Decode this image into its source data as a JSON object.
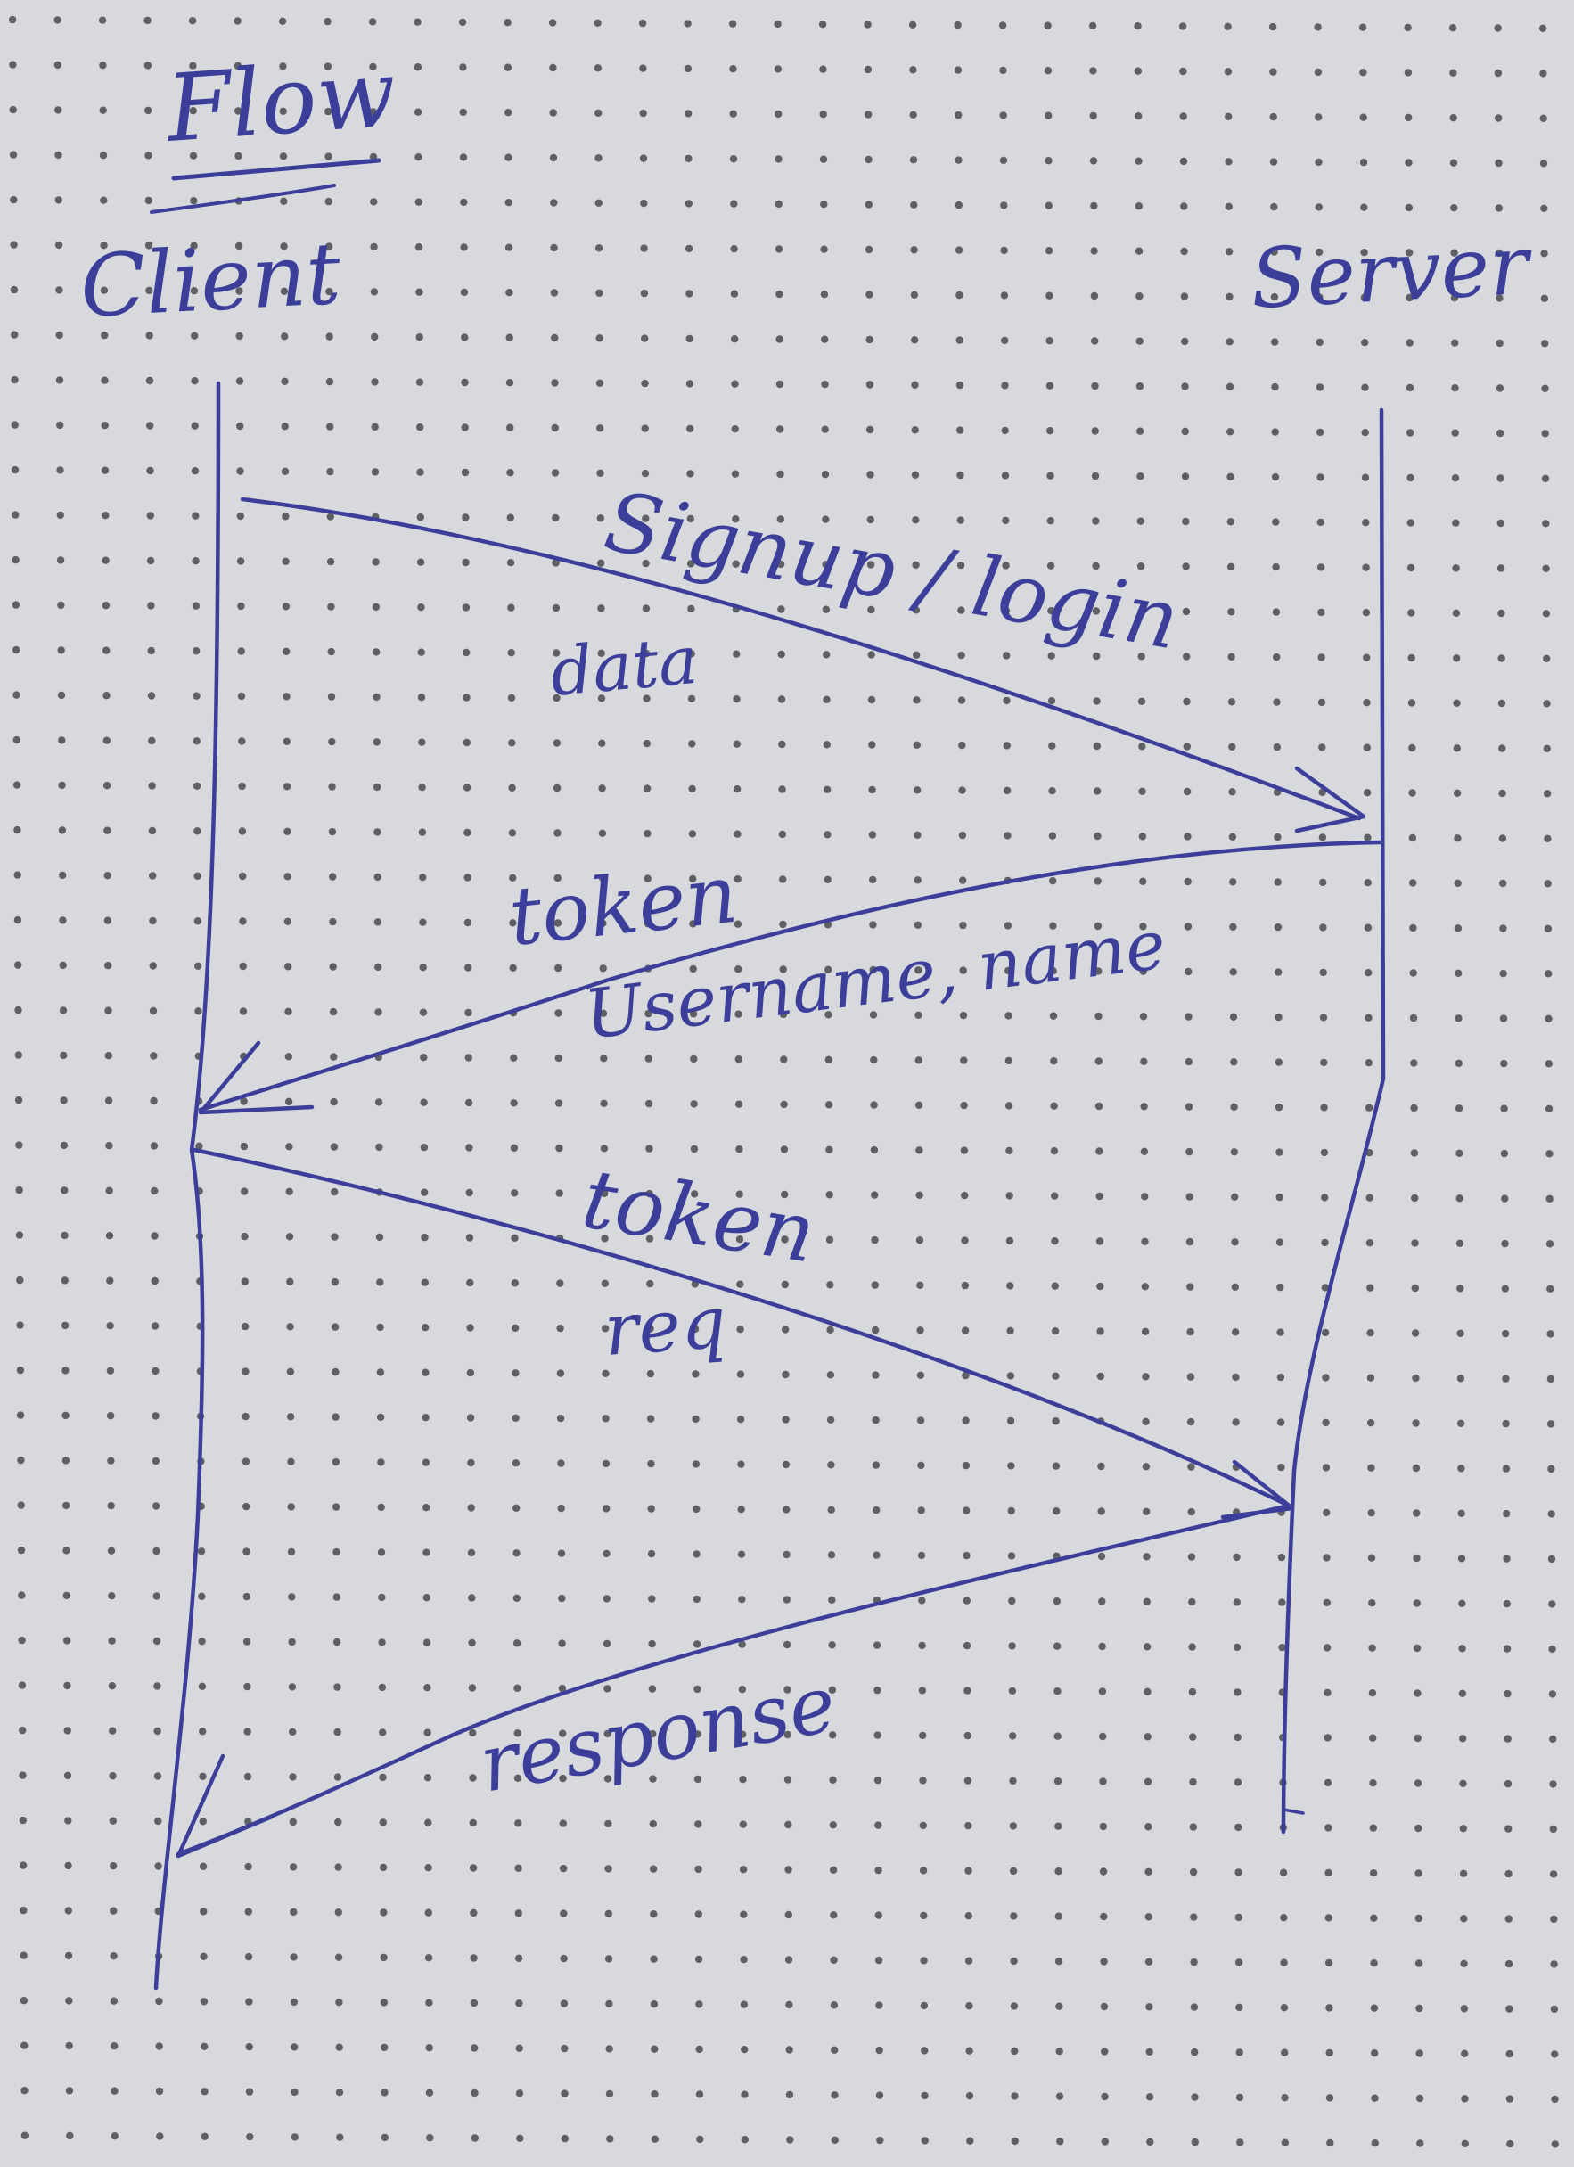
{
  "title": "Flow",
  "participants": {
    "client": "Client",
    "server": "Server"
  },
  "messages": [
    {
      "label": "Signup / login",
      "sublabel": "data",
      "from": "Client",
      "to": "Server"
    },
    {
      "label": "token",
      "sublabel": "Username, name",
      "from": "Server",
      "to": "Client"
    },
    {
      "label": "token",
      "sublabel": "req",
      "from": "Client",
      "to": "Server"
    },
    {
      "label": "response",
      "sublabel": "",
      "from": "Server",
      "to": "Client"
    }
  ],
  "colors": {
    "ink": "#3b3f9a",
    "paper": "#d8d9dd",
    "dots": "#4a4a4e"
  }
}
